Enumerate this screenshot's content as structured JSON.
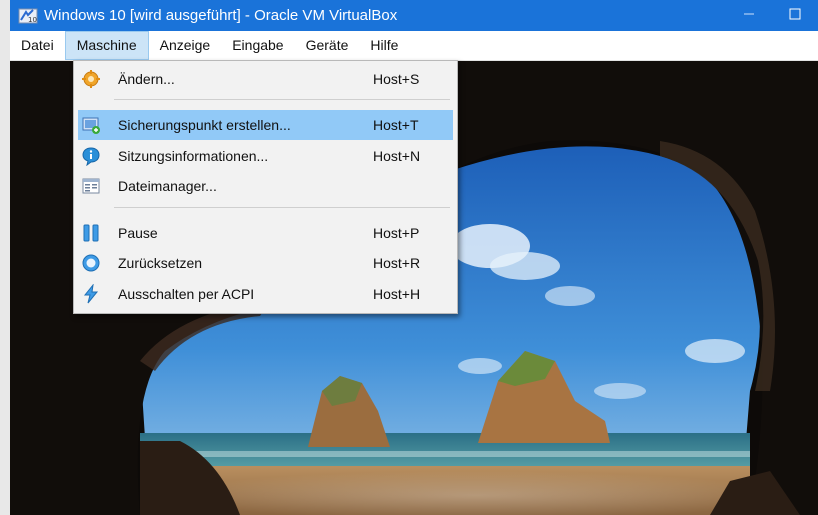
{
  "window": {
    "title": "Windows 10 [wird ausgeführt] - Oracle VM VirtualBox",
    "controls": {
      "minimize": "minimize-icon",
      "maximize": "maximize-icon"
    }
  },
  "menubar": {
    "items": [
      "Datei",
      "Maschine",
      "Anzeige",
      "Eingabe",
      "Geräte",
      "Hilfe"
    ],
    "active": "Maschine"
  },
  "dropdown": {
    "items": [
      {
        "label": "Ändern...",
        "shortcut": "Host+S",
        "icon": "settings-gear-icon"
      },
      {
        "label": "Sicherungspunkt erstellen...",
        "shortcut": "Host+T",
        "icon": "snapshot-icon",
        "highlighted": true
      },
      {
        "label": "Sitzungsinformationen...",
        "shortcut": "Host+N",
        "icon": "session-info-icon"
      },
      {
        "label": "Dateimanager...",
        "shortcut": "",
        "icon": "file-manager-icon"
      },
      {
        "label": "Pause",
        "shortcut": "Host+P",
        "icon": "pause-icon"
      },
      {
        "label": "Zurücksetzen",
        "shortcut": "Host+R",
        "icon": "reset-icon"
      },
      {
        "label": "Ausschalten per ACPI",
        "shortcut": "Host+H",
        "icon": "acpi-shutdown-icon"
      }
    ]
  },
  "colors": {
    "titlebar": "#1a73d9",
    "menu_highlight": "#91c9f7",
    "menubar_active": "#cce4f7"
  },
  "guest_screen": {
    "content": "Windows 10 lock screen wallpaper (sea cave view)"
  }
}
